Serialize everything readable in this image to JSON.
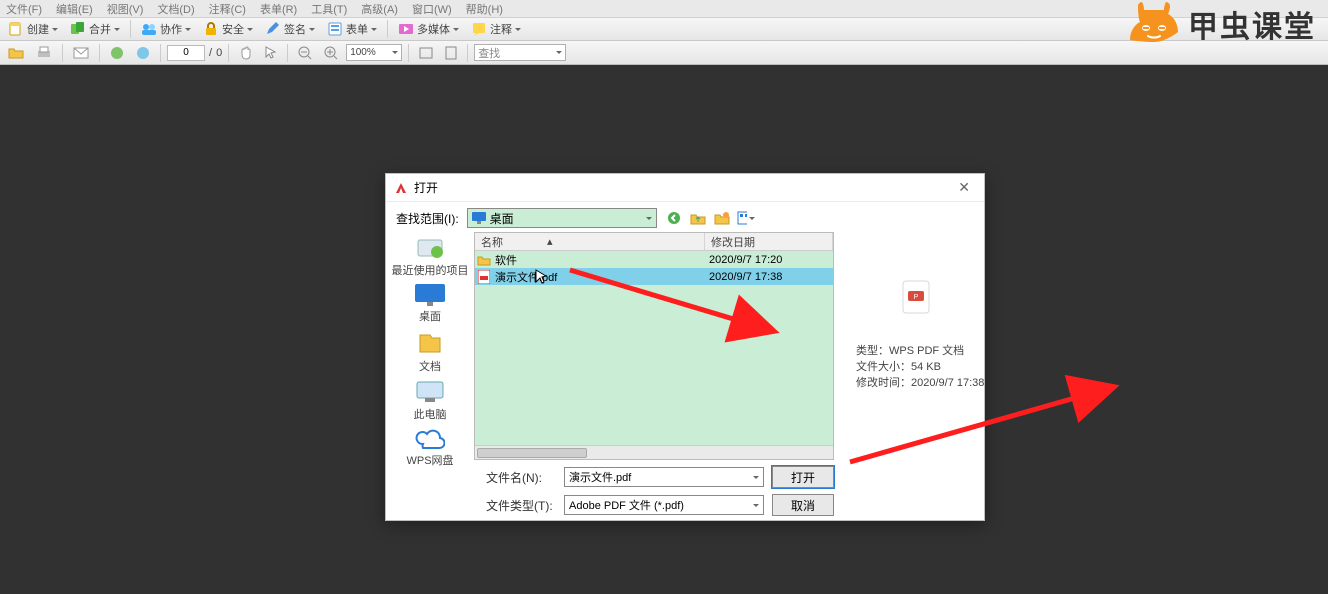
{
  "brand": "甲虫课堂",
  "menu": {
    "file": "文件(F)",
    "edit": "编辑(E)",
    "view": "视图(V)",
    "document": "文档(D)",
    "comments": "注释(C)",
    "forms": "表单(R)",
    "tools": "工具(T)",
    "advanced": "高级(A)",
    "window": "窗口(W)",
    "help": "帮助(H)"
  },
  "toolbar1": {
    "create": "创建",
    "combine": "合并",
    "collab": "协作",
    "secure": "安全",
    "sign": "签名",
    "form": "表单",
    "media": "多媒体",
    "annotate": "注释"
  },
  "toolbar2": {
    "pageInput": "0",
    "pageSep": "/",
    "pageTotal": "0",
    "zoom": "100%",
    "find": "查找"
  },
  "dialog": {
    "title": "打开",
    "lookInLabel": "查找范围(I):",
    "lookInValue": "桌面",
    "col_name": "名称",
    "col_date": "修改日期",
    "rows": [
      {
        "name": "软件",
        "date": "2020/9/7 17:20",
        "type": "folder"
      },
      {
        "name": "演示文件.pdf",
        "date": "2020/9/7 17:38",
        "type": "pdf"
      }
    ],
    "places": {
      "recent": "最近使用的项目",
      "desktop": "桌面",
      "documents": "文档",
      "computer": "此电脑",
      "wps": "WPS网盘"
    },
    "fileNameLabel": "文件名(N):",
    "fileNameValue": "演示文件.pdf",
    "fileTypeLabel": "文件类型(T):",
    "fileTypeValue": "Adobe PDF 文件 (*.pdf)",
    "openBtn": "打开",
    "cancelBtn": "取消",
    "preview": {
      "type": "类型：WPS PDF 文档",
      "size": "文件大小：54 KB",
      "mtime": "修改时间：2020/9/7 17:38"
    }
  }
}
